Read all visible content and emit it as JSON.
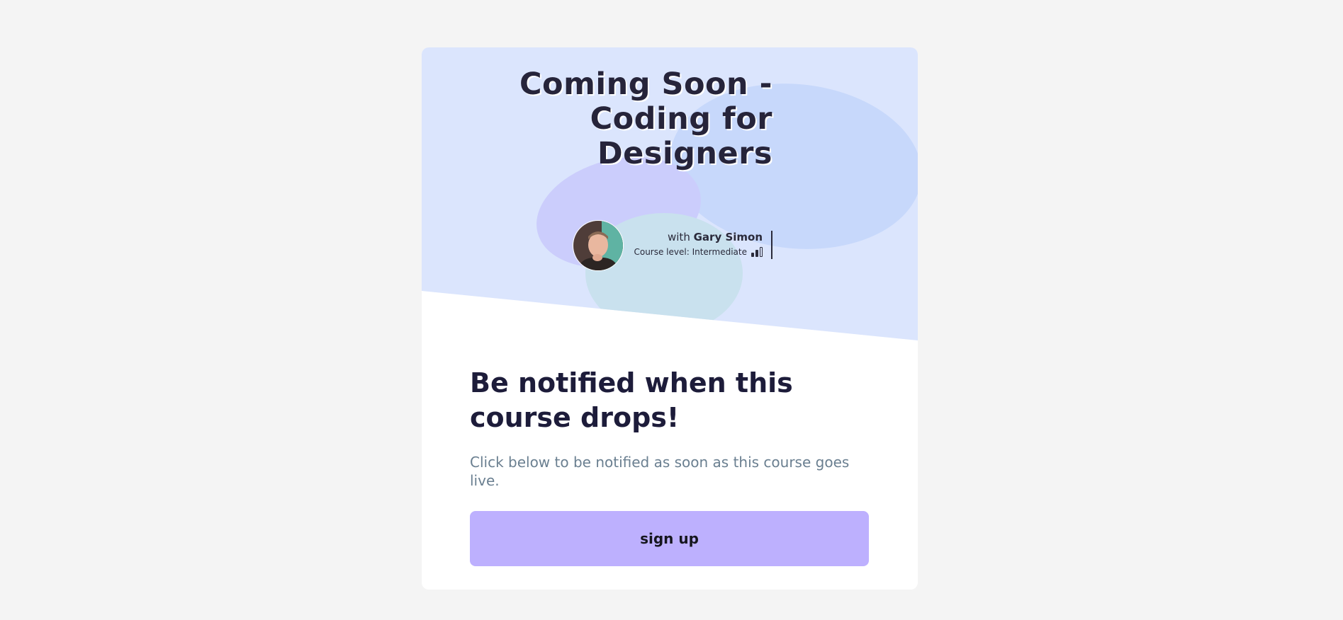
{
  "hero": {
    "title": "Coming Soon -\nCoding for\nDesigners",
    "instructor_prefix": "with",
    "instructor_name": "Gary Simon",
    "course_level": "Course level: Intermediate"
  },
  "content": {
    "headline": "Be notified when this course drops!",
    "subtext": "Click below to be notified as soon as this course goes live.",
    "signup_label": "sign up"
  },
  "icons": {
    "avatar": "instructor-photo",
    "level": "level-bars-icon"
  },
  "colors": {
    "hero_bg": "#dbe5fd",
    "button_bg": "#bdb0fe",
    "title": "#26243a",
    "subtext": "#6a7f90"
  },
  "level_indicator": {
    "filled": 2,
    "total": 3
  }
}
